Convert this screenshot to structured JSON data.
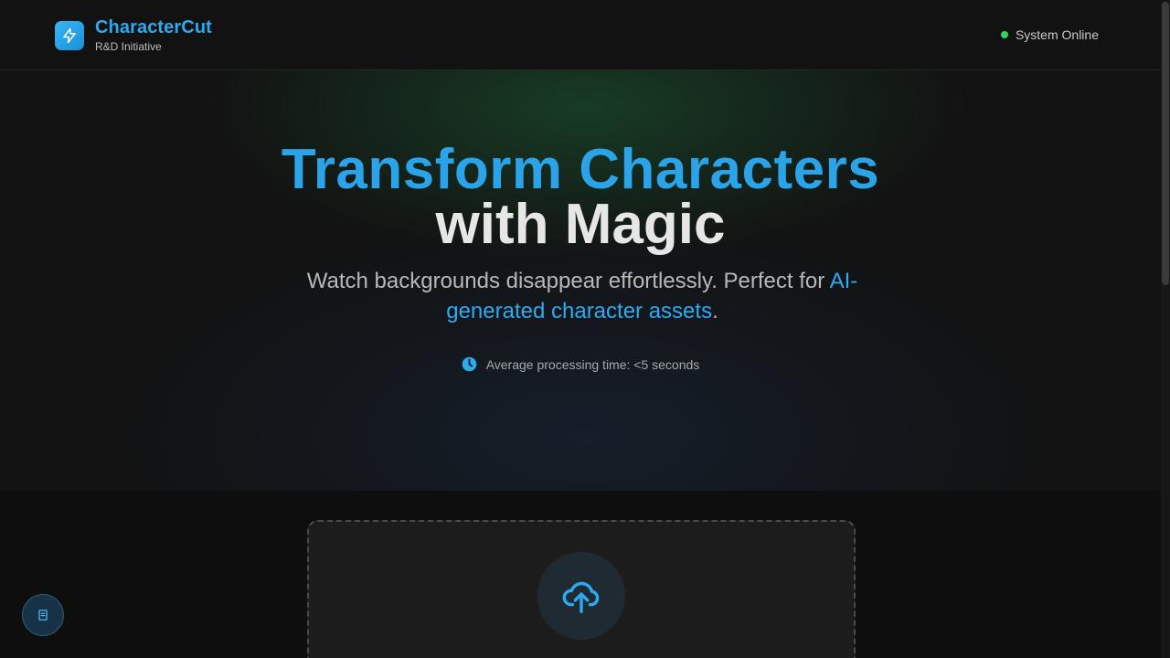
{
  "header": {
    "brand_name": "CharacterCut",
    "brand_sub": "R&D Initiative",
    "status_text": "System Online",
    "status_color": "#34d363"
  },
  "hero": {
    "title_line1": "Transform Characters",
    "title_line2": "with Magic",
    "subtitle_prefix": "Watch backgrounds disappear effortlessly. Perfect for ",
    "subtitle_highlight": "AI-generated character assets",
    "subtitle_suffix": ".",
    "processing_text": "Average processing time: <5 seconds"
  },
  "upload": {
    "icon": "cloud-upload-icon"
  },
  "floating_button": {
    "icon": "document-icon"
  },
  "colors": {
    "accent": "#2ea8ef",
    "background": "#121212"
  }
}
